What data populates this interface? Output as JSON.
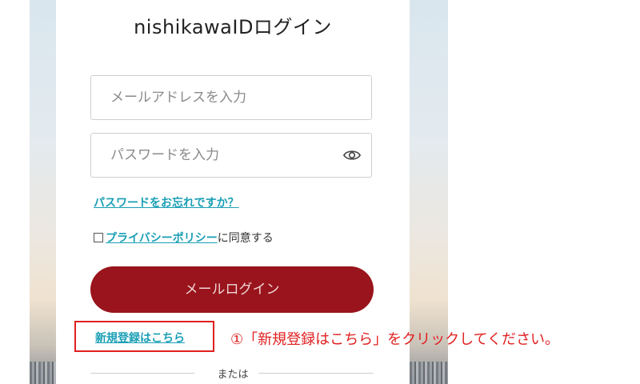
{
  "login": {
    "title": "nishikawaIDログイン",
    "email_placeholder": "メールアドレスを入力",
    "password_placeholder": "パスワードを入力",
    "forgot_password": "パスワードをお忘れですか？",
    "privacy_policy_link": "プライバシーポリシー",
    "agree_suffix": "に同意する",
    "login_button": "メールログイン",
    "signup_link": "新規登録はこちら",
    "or_text": "または"
  },
  "annotation": {
    "text": "①「新規登録はこちら」をクリックしてください。"
  },
  "icons": {
    "password_toggle": "eye-icon"
  },
  "colors": {
    "primary_button": "#99141c",
    "link": "#1a9fb5",
    "annotation": "#e02020"
  }
}
